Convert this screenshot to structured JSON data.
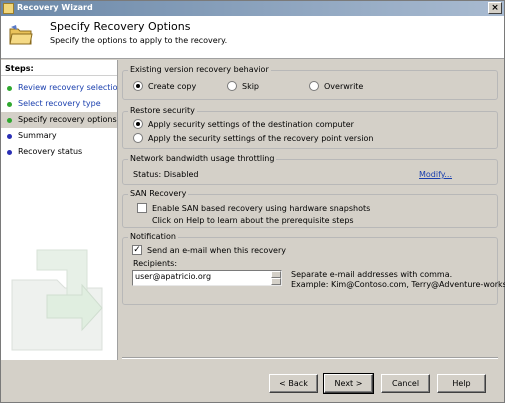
{
  "window": {
    "title": "Recovery Wizard",
    "close_glyph": "×"
  },
  "header": {
    "title": "Specify Recovery Options",
    "subtitle": "Specify the options to apply to the recovery."
  },
  "sidebar": {
    "heading": "Steps:",
    "items": [
      {
        "label": "Review recovery selection",
        "bullet_color": "#2fa82f",
        "state": "done"
      },
      {
        "label": "Select recovery type",
        "bullet_color": "#2fa82f",
        "state": "done"
      },
      {
        "label": "Specify recovery options",
        "bullet_color": "#2fa82f",
        "state": "current"
      },
      {
        "label": "Summary",
        "bullet_color": "#2a2fb5",
        "state": "pending"
      },
      {
        "label": "Recovery status",
        "bullet_color": "#2a2fb5",
        "state": "pending"
      }
    ]
  },
  "existing_version": {
    "legend": "Existing version recovery behavior",
    "options": [
      "Create copy",
      "Skip",
      "Overwrite"
    ],
    "selected": "Create copy"
  },
  "restore_security": {
    "legend": "Restore security",
    "options": [
      "Apply security settings of the destination computer",
      "Apply the security settings of the recovery point version"
    ],
    "selected": "Apply security settings of the destination computer"
  },
  "throttling": {
    "legend": "Network bandwidth usage throttling",
    "status": "Status: Disabled",
    "modify_link": "Modify..."
  },
  "san": {
    "legend": "SAN Recovery",
    "checkbox_label": "Enable SAN based recovery using hardware snapshots",
    "checked": false,
    "help_text": "Click on Help to learn about the prerequisite steps"
  },
  "notification": {
    "legend": "Notification",
    "checkbox_label": "Send an e-mail when this recovery",
    "checked": true,
    "recipients_label": "Recipients:",
    "recipients_value": "user@apatricio.org",
    "hint_line1": "Separate e-mail addresses with comma.",
    "hint_line2": "Example: Kim@Contoso.com, Terry@Adventure-works.com"
  },
  "buttons": {
    "back": "< Back",
    "next": "Next >",
    "cancel": "Cancel",
    "help": "Help"
  },
  "colors": {
    "link": "#1a3fae",
    "titlebar_start": "#6b88a8",
    "titlebar_end": "#a9bbd1"
  }
}
